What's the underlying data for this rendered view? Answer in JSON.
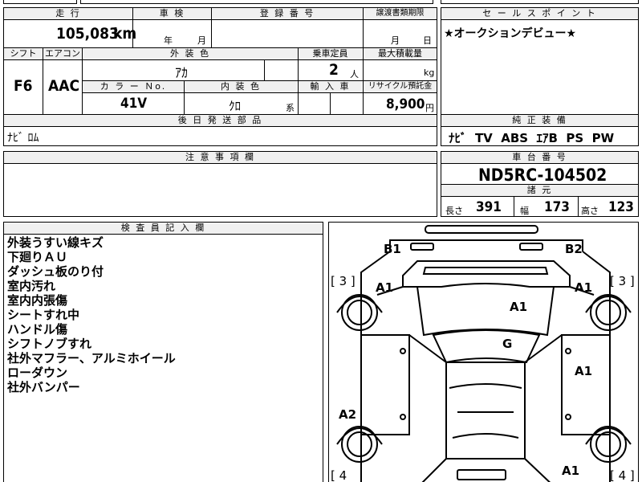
{
  "top_fragment": "",
  "mileage": {
    "label": "走 行",
    "value": "105,083",
    "unit": "km"
  },
  "inspection": {
    "label": "車 検",
    "year_unit": "年",
    "month_unit": "月"
  },
  "registration": {
    "label": "登 録 番 号"
  },
  "transfer": {
    "label": "譲渡書類期限",
    "month_unit": "月",
    "day_unit": "日"
  },
  "sales_point": {
    "label": "セ ー ル ス ポ イ ン ト",
    "text": "★オークションデビュー★"
  },
  "shift": {
    "label": "シフト",
    "value": "F6"
  },
  "aircon": {
    "label": "エアコン",
    "value": "AAC"
  },
  "exterior_color": {
    "label": "外 装 色",
    "value": "ｱｶ"
  },
  "capacity": {
    "label": "乗車定員",
    "value": "2",
    "unit": "人"
  },
  "max_load": {
    "label": "最大積載量",
    "unit": "kg"
  },
  "color_no": {
    "label": "カ ラ ー Ｎo.",
    "value": "41V"
  },
  "interior_color": {
    "label": "内 装 色",
    "value": "ｸﾛ",
    "suffix": "系"
  },
  "import": {
    "label": "輸 入 車"
  },
  "recycle": {
    "label": "リサイクル預託金",
    "value": "8,900",
    "unit": "円"
  },
  "later_parts": {
    "label": "後 日 発 送 部 品",
    "value": "ﾅﾋﾞ ﾛﾑ"
  },
  "equipment": {
    "label": "純 正 装 備",
    "value": "ﾅﾋﾞ  TV  ABS  ｴｱB  PS  PW"
  },
  "caution": {
    "label": "注 意 事 項 欄"
  },
  "chassis": {
    "label": "車 台 番 号",
    "value": "ND5RC-104502"
  },
  "dimensions": {
    "label": "諸 元",
    "length_label": "長さ",
    "length": "391",
    "width_label": "幅",
    "width": "173",
    "height_label": "高さ",
    "height": "123"
  },
  "inspector": {
    "label": "検 査 員 記 入 欄",
    "notes": [
      "外装うすい線キズ",
      "下廻りＡＵ",
      "ダッシュ板のり付",
      "室内汚れ",
      "室内内張傷",
      "シートすれ中",
      "ハンドル傷",
      "シフトノブすれ",
      "社外マフラー、アルミホイール",
      "ローダウン",
      "社外バンパー"
    ]
  },
  "diagram": {
    "marks": {
      "b1": "B1",
      "b2": "B2",
      "a1_left_fender": "A1",
      "a1_right_fender": "A1",
      "a1_hood": "A1",
      "g_windshield": "G",
      "a1_right_door": "A1",
      "a2_left_rear": "A2",
      "a1_right_rear": "A1",
      "tire_fl": "[ 3 ]",
      "tire_fr": "[ 3 ]",
      "tire_rl": "[ 4",
      "tire_rr": "[ 4 ]"
    }
  }
}
